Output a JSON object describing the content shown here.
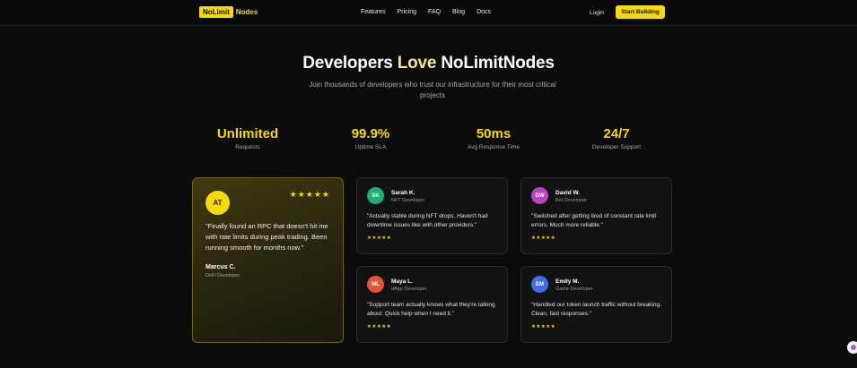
{
  "nav": {
    "logo_pill": "NoLimit",
    "logo_text": "Nodes",
    "links": [
      "Features",
      "Pricing",
      "FAQ",
      "Blog",
      "Docs"
    ],
    "login": "Login",
    "cta": "Start Building"
  },
  "hero": {
    "title_part1": "Developers",
    "title_highlight": "Love",
    "title_part2": "NoLimitNodes",
    "subtitle": "Join thousands of developers who trust our infrastructure for their most critical projects"
  },
  "stats": [
    {
      "value": "Unlimited",
      "label": "Requests"
    },
    {
      "value": "99.9%",
      "label": "Uptime SLA"
    },
    {
      "value": "50ms",
      "label": "Avg Response Time"
    },
    {
      "value": "24/7",
      "label": "Developer Support"
    }
  ],
  "featured": {
    "initials": "AT",
    "stars": "★★★★★",
    "quote": "\"Finally found an RPC that doesn't hit me with rate limits during peak trading. Been running smooth for months now.\"",
    "name": "Marcus C.",
    "role": "DeFi Developer"
  },
  "testimonials": [
    {
      "initials": "SK",
      "name": "Sarah K.",
      "role": "NFT Developer",
      "color": "#1fae74",
      "quote": "\"Actually stable during NFT drops. Haven't had downtime issues like with other providers.\"",
      "stars": "★★★★★"
    },
    {
      "initials": "DW",
      "name": "David W.",
      "role": "Bot Developer",
      "color": "#b646c2",
      "quote": "\"Switched after getting tired of constant rate limit errors. Much more reliable.\"",
      "stars": "★★★★★"
    },
    {
      "initials": "ML",
      "name": "Maya L.",
      "role": "dApp Developer",
      "color": "#e2553a",
      "quote": "\"Support team actually knows what they're talking about. Quick help when I need it.\"",
      "stars": "★★★★★"
    },
    {
      "initials": "EM",
      "name": "Emily M.",
      "role": "Game Developer",
      "color": "#3d6fe0",
      "quote": "\"Handled our token launch traffic without breaking. Clean, fast responses.\"",
      "stars": "★★★★★"
    }
  ],
  "colors": {
    "accent": "#f5d90a",
    "background": "#0c0b0b"
  }
}
